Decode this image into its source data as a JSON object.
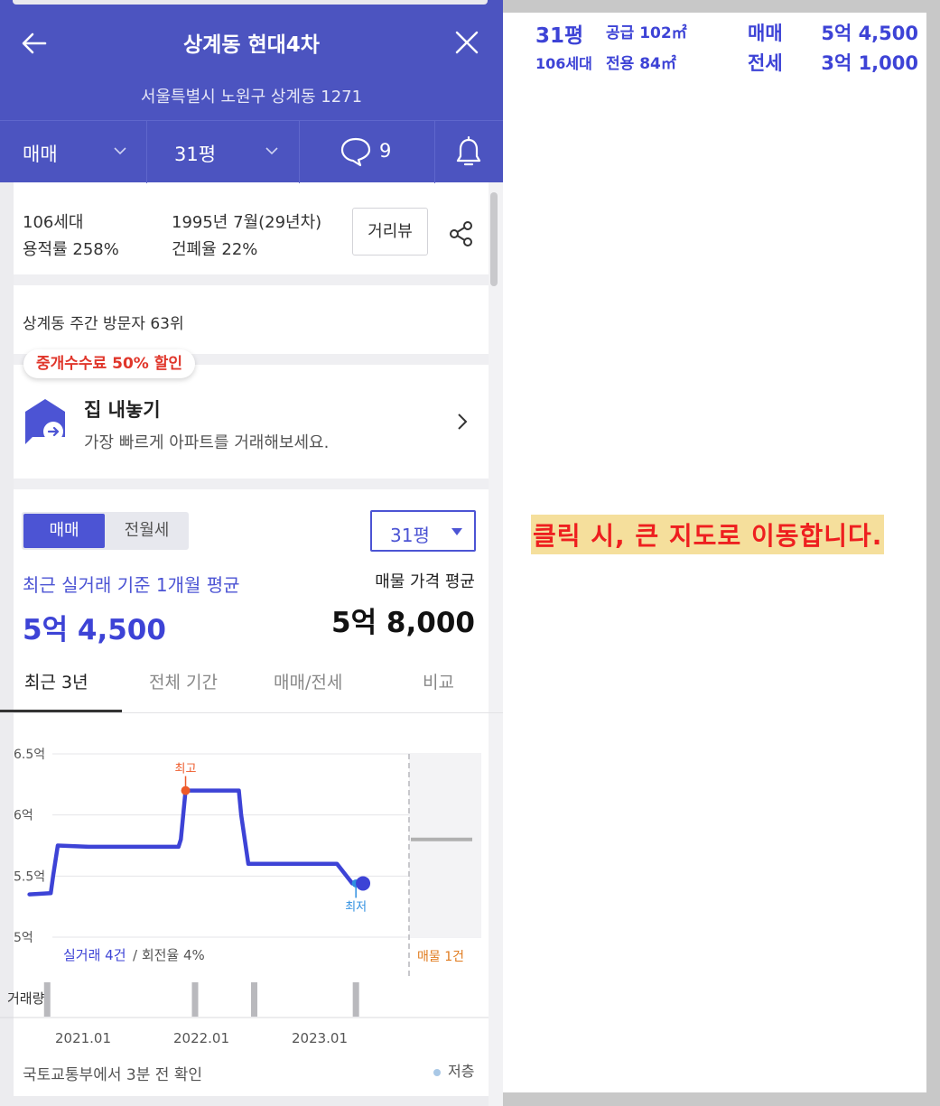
{
  "header": {
    "title": "상계동 현대4차",
    "address": "서울특별시 노원구 상계동 1271",
    "trade_type": "매매",
    "size": "31평",
    "comment_count": "9"
  },
  "info": {
    "households": "106세대",
    "floor_area_ratio": "용적률 258%",
    "built": "1995년 7월(29년차)",
    "building_coverage": "건폐율 22%",
    "street_view_label": "거리뷰"
  },
  "visitors": "상계동 주간 방문자 63위",
  "promo": {
    "badge": "중개수수료 50% 할인",
    "title": "집 내놓기",
    "subtitle": "가장 빠르게 아파트를 거래해보세요."
  },
  "price": {
    "toggle_sale": "매매",
    "toggle_rent": "전월세",
    "size_select": "31평",
    "avg_label": "최근 실거래 기준 1개월 평균",
    "avg_value": "5억 4,500",
    "listing_label": "매물 가격 평균",
    "listing_value": "5억 8,000"
  },
  "period_tabs": [
    "최근 3년",
    "전체 기간",
    "매매/전세",
    "비교"
  ],
  "chart_data": {
    "type": "line",
    "ylabel": "",
    "y_ticks": [
      "6.5억",
      "6억",
      "5.5억",
      "5억"
    ],
    "y_tick_values": [
      6.5,
      6.0,
      5.5,
      5.0
    ],
    "ylim": [
      5.0,
      6.5
    ],
    "x_ticks": [
      "2021.01",
      "2022.01",
      "2023.01"
    ],
    "x_tick_values": [
      2021.0,
      2022.0,
      2023.0
    ],
    "series": [
      {
        "x": [
          2020.6,
          2020.78,
          2020.8,
          2020.84,
          2021.1,
          2021.6,
          2021.86,
          2021.88,
          2021.92,
          2022.2,
          2022.37,
          2022.39,
          2022.45,
          2022.85,
          2023.2,
          2023.33,
          2023.42
        ],
        "values": [
          5.35,
          5.36,
          5.5,
          5.75,
          5.74,
          5.74,
          5.74,
          5.8,
          6.2,
          6.2,
          6.2,
          6.0,
          5.6,
          5.6,
          5.6,
          5.44,
          5.44
        ]
      }
    ],
    "high_label": "최고",
    "high_point": {
      "x": 2021.92,
      "value": 6.2
    },
    "low_label": "최저",
    "low_point": {
      "x": 2023.36,
      "value": 5.44
    },
    "current_point": {
      "x": 2023.42,
      "value": 5.44
    },
    "listing_level": 5.8,
    "volume_label": "거래량",
    "volume_x": [
      2020.75,
      2022.0,
      2022.5,
      2023.36
    ],
    "trades_label": "실거래 4건",
    "turnover_label": "/ 회전율 4%",
    "listing_count_label": "매물 1건",
    "colors": {
      "line": "#3d43d6",
      "high": "#ee5a2a",
      "low": "#2f8fe0",
      "listing": "#b0b0b0",
      "listing_text": "#e07b1e"
    }
  },
  "footer": {
    "confirm_text": "국토교통부에서 3분 전 확인",
    "low_floor_label": "저층"
  },
  "summary": {
    "size": "31평",
    "households": "106세대",
    "supply_area": "공급 102㎡",
    "exclusive_area": "전용 84㎡",
    "sale_label": "매매",
    "sale_value": "5억 4,500",
    "jeonse_label": "전세",
    "jeonse_value": "3억 1,000"
  },
  "map_note": "클릭 시, 큰 지도로 이동합니다."
}
